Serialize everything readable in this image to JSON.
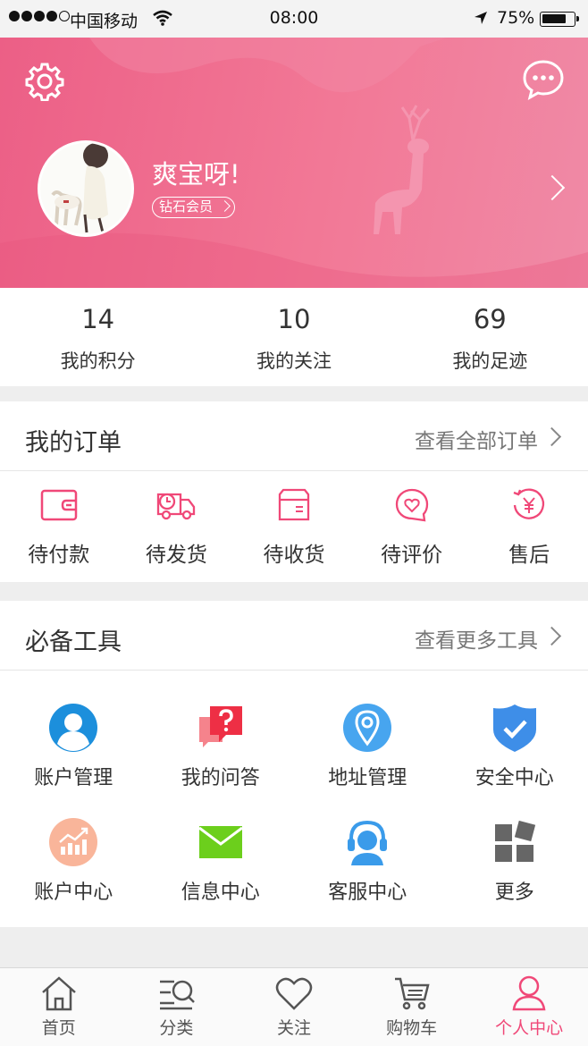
{
  "status_bar": {
    "carrier": "中国移动",
    "time": "08:00",
    "battery": "75%"
  },
  "profile": {
    "username": "爽宝呀!",
    "member_badge": "钻石会员"
  },
  "stats": [
    {
      "value": "14",
      "label": "我的积分"
    },
    {
      "value": "10",
      "label": "我的关注"
    },
    {
      "value": "69",
      "label": "我的足迹"
    }
  ],
  "orders": {
    "title": "我的订单",
    "more": "查看全部订单",
    "items": [
      {
        "label": "待付款",
        "icon": "wallet-icon"
      },
      {
        "label": "待发货",
        "icon": "delivery-truck-icon"
      },
      {
        "label": "待收货",
        "icon": "package-icon"
      },
      {
        "label": "待评价",
        "icon": "heart-chat-icon"
      },
      {
        "label": "售后",
        "icon": "yuan-refund-icon"
      }
    ]
  },
  "tools": {
    "title": "必备工具",
    "more": "查看更多工具",
    "items": [
      {
        "label": "账户管理",
        "icon": "user-account-icon"
      },
      {
        "label": "我的问答",
        "icon": "question-icon"
      },
      {
        "label": "地址管理",
        "icon": "location-pin-icon"
      },
      {
        "label": "安全中心",
        "icon": "shield-check-icon"
      },
      {
        "label": "账户中心",
        "icon": "growth-chart-icon"
      },
      {
        "label": "信息中心",
        "icon": "mail-icon"
      },
      {
        "label": "客服中心",
        "icon": "headset-icon"
      },
      {
        "label": "更多",
        "icon": "grid-more-icon"
      }
    ]
  },
  "tabbar": [
    {
      "label": "首页",
      "icon": "home-icon"
    },
    {
      "label": "分类",
      "icon": "category-search-icon"
    },
    {
      "label": "关注",
      "icon": "heart-icon"
    },
    {
      "label": "购物车",
      "icon": "cart-icon"
    },
    {
      "label": "个人中心",
      "icon": "person-icon"
    }
  ],
  "colors": {
    "accent": "#f04878",
    "header": "#ee6b8f"
  }
}
